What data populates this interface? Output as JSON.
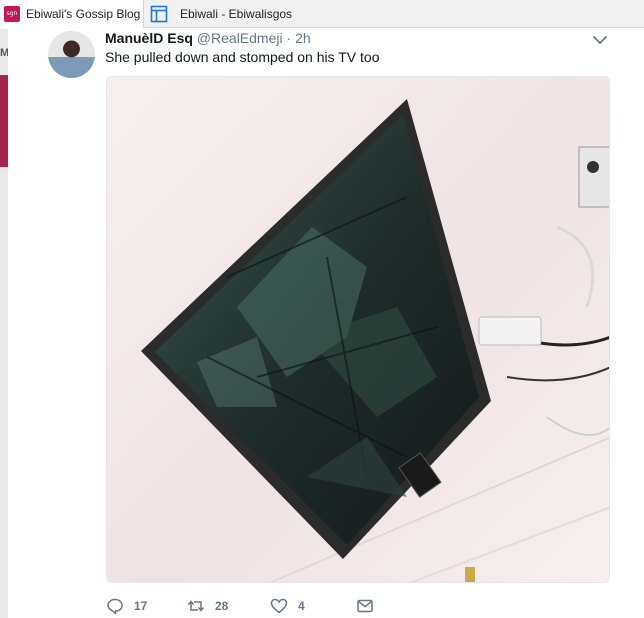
{
  "tabs": [
    {
      "title": "Ebiwali's Gossip Blog",
      "icon": "site-logo-icon",
      "icon_text": "sgn"
    },
    {
      "title": "Ebiwali - Ebiwalisgos",
      "icon": "page-icon"
    }
  ],
  "tweet": {
    "name": "ManuèlD Esq",
    "handle": "@RealEdmeji",
    "separator": "·",
    "time": "2h",
    "text": "She pulled down and stomped on his TV too",
    "media": {
      "subject": "broken-tv-photo"
    },
    "actions": {
      "reply_count": "17",
      "retweet_count": "28",
      "like_count": "4"
    }
  },
  "colors": {
    "name": "#14171a",
    "meta": "#657786",
    "accent_left": "#a3264a"
  }
}
